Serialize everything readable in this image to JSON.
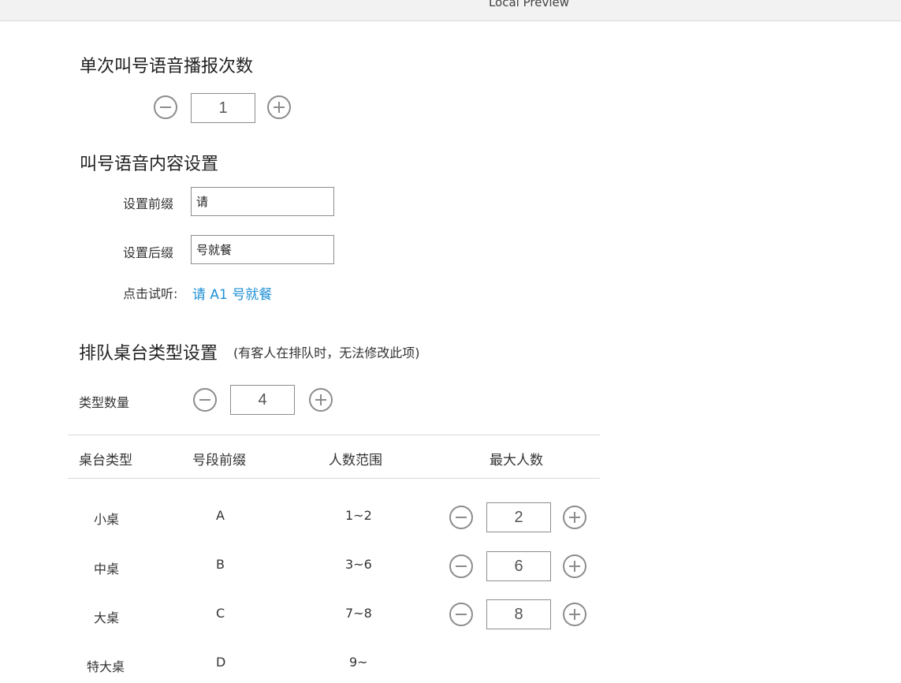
{
  "window": {
    "title": "Local Preview"
  },
  "broadcast": {
    "heading": "单次叫号语音播报次数",
    "count": "1"
  },
  "voice": {
    "heading": "叫号语音内容设置",
    "prefix_label": "设置前缀",
    "prefix_value": "请",
    "suffix_label": "设置后缀",
    "suffix_value": "号就餐",
    "preview_label": "点击试听:",
    "preview_link": "请 A1 号就餐"
  },
  "table_types": {
    "heading": "排队桌台类型设置",
    "note": "(有客人在排队时，无法修改此项)",
    "count_label": "类型数量",
    "count": "4",
    "columns": [
      "桌台类型",
      "号段前缀",
      "人数范围",
      "最大人数"
    ],
    "rows": [
      {
        "type": "小桌",
        "prefix": "A",
        "range": "1~2",
        "max": "2"
      },
      {
        "type": "中桌",
        "prefix": "B",
        "range": "3~6",
        "max": "6"
      },
      {
        "type": "大桌",
        "prefix": "C",
        "range": "7~8",
        "max": "8"
      },
      {
        "type": "特大桌",
        "prefix": "D",
        "range": "9~"
      }
    ]
  },
  "colors": {
    "link": "#1e90d6",
    "border": "#8c8c8c"
  }
}
